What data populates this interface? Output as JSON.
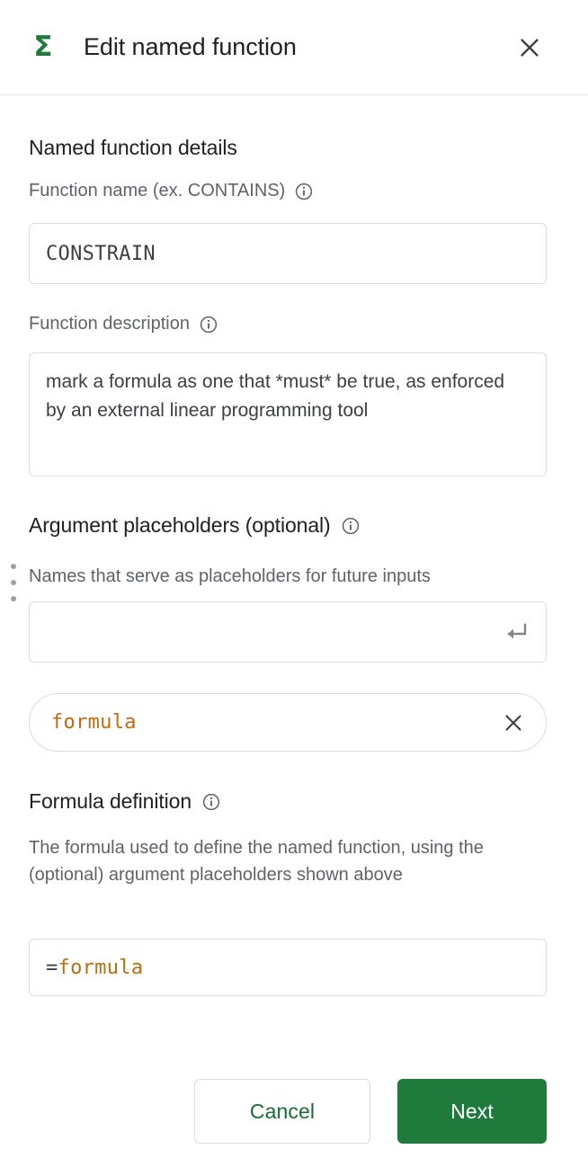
{
  "header": {
    "icon": "sigma-icon",
    "title": "Edit named function",
    "close_label": "×"
  },
  "sections": {
    "details": {
      "title": "Named function details",
      "name_field": {
        "label": "Function name (ex. CONTAINS)",
        "info": "info-icon",
        "value": "CONSTRAIN",
        "placeholder": ""
      },
      "description_field": {
        "label": "Function description",
        "info": "info-icon",
        "value": "mark a formula as one that *must* be true, as enforced by an external linear programming tool",
        "placeholder": ""
      }
    },
    "arguments": {
      "title": "Argument placeholders (optional)",
      "info": "info-icon",
      "hint": "Names that serve as placeholders for future inputs",
      "new_input": {
        "value": "",
        "placeholder": "",
        "submit_icon": "enter-return-icon"
      },
      "chips": [
        {
          "label": "formula",
          "remove_icon": "close-icon"
        }
      ],
      "drag_handle_icon": "drag-dots-icon"
    },
    "formula": {
      "title": "Formula definition",
      "info": "info-icon",
      "hint": "The formula used to define the named function, using the (optional) argument placeholders shown above",
      "input": {
        "prefix": "=",
        "argument": "formula",
        "placeholder": ""
      }
    }
  },
  "footer": {
    "cancel_label": "Cancel",
    "next_label": "Next"
  },
  "colors": {
    "brand_green": "#1e7b3c",
    "cancel_text_green": "#156e34",
    "argument_orange": "#bf6c10",
    "border_gray": "#dadce0",
    "secondary_text": "#5f6368",
    "primary_text": "#202124"
  }
}
